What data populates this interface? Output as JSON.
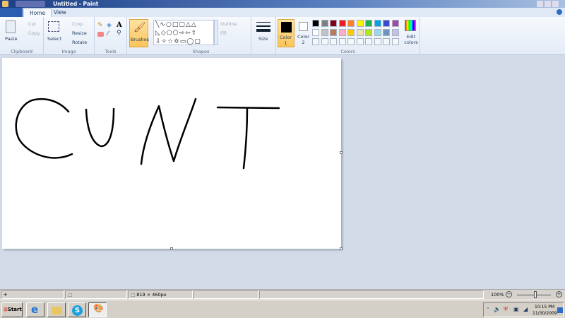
{
  "window": {
    "title": "Untitled - Paint"
  },
  "tabs": [
    {
      "label": "Home"
    },
    {
      "label": "View"
    }
  ],
  "ribbon": {
    "clipboard": {
      "label": "Clipboard",
      "paste": "Paste",
      "cut": "Cut",
      "copy": "Copy"
    },
    "image": {
      "label": "Image",
      "select": "Select",
      "crop": "Crop",
      "resize": "Resize",
      "rotate": "Rotate"
    },
    "tools": {
      "label": "Tools"
    },
    "brushes": "Brushes",
    "shapes": {
      "label": "Shapes",
      "outline": "Outline",
      "fill": "Fill"
    },
    "size": "Size",
    "colors": {
      "label": "Colors",
      "color1": "Color\n1",
      "color2": "Color\n2",
      "edit": "Edit colors",
      "palette_row1": [
        "#000000",
        "#7f7f7f",
        "#880015",
        "#ed1c24",
        "#ff7f27",
        "#fff200",
        "#22b14c",
        "#00a2e8",
        "#3f48cc",
        "#a349a4"
      ],
      "palette_row2": [
        "#ffffff",
        "#c3c3c3",
        "#b97a57",
        "#ffaec9",
        "#ffc90e",
        "#efe4b0",
        "#b5e61d",
        "#99d9ea",
        "#7092be",
        "#c8bfe7"
      ],
      "color1_value": "#000000",
      "color2_value": "#ffffff"
    }
  },
  "status": {
    "canvas_size": "819 × 460px",
    "zoom": "100%"
  },
  "taskbar": {
    "start": "Start",
    "time": "10:15 PM",
    "date": "11/30/2009"
  }
}
